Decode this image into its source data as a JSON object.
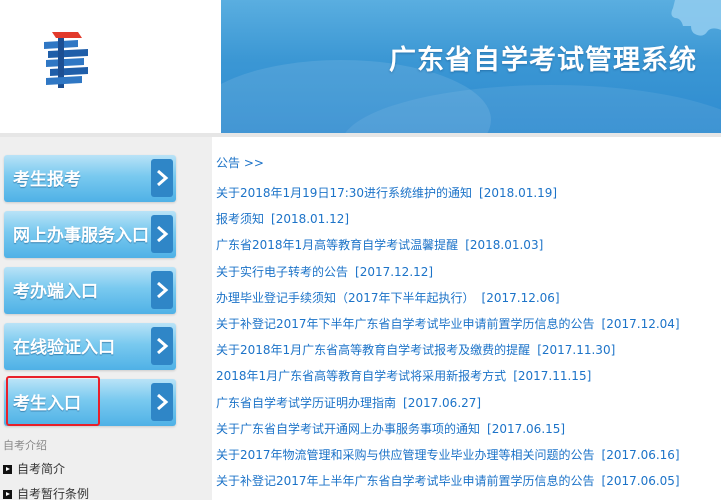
{
  "header": {
    "site_title": "广东省自学考试管理系统",
    "banner_color": "#3b97d4",
    "logo_icon": "exam-logo-icon",
    "decoration_icon": "puzzle-piece-icon"
  },
  "sidebar": {
    "buttons": [
      {
        "label": "考生报考"
      },
      {
        "label": "网上办事服务入口"
      },
      {
        "label": "考办端入口"
      },
      {
        "label": "在线验证入口"
      },
      {
        "label": "考生入口"
      }
    ],
    "highlight_color": "#e8202a",
    "intro_header": "自考介绍",
    "intro_links": [
      "自考简介",
      "自考暂行条例"
    ]
  },
  "notices": {
    "title": "公告 >>",
    "items": [
      {
        "title": "关于2018年1月19日17:30进行系统维护的通知",
        "date": "[2018.01.19]"
      },
      {
        "title": "报考须知",
        "date": "[2018.01.12]"
      },
      {
        "title": "广东省2018年1月高等教育自学考试温馨提醒",
        "date": "[2018.01.03]"
      },
      {
        "title": "关于实行电子转考的公告",
        "date": "[2017.12.12]"
      },
      {
        "title": "办理毕业登记手续须知（2017年下半年起执行）",
        "date": "[2017.12.06]"
      },
      {
        "title": "关于补登记2017年下半年广东省自学考试毕业申请前置学历信息的公告",
        "date": "[2017.12.04]"
      },
      {
        "title": "关于2018年1月广东省高等教育自学考试报考及缴费的提醒",
        "date": "[2017.11.30]"
      },
      {
        "title": "2018年1月广东省高等教育自学考试将采用新报考方式",
        "date": "[2017.11.15]"
      },
      {
        "title": "广东省自学考试学历证明办理指南",
        "date": "[2017.06.27]"
      },
      {
        "title": "关于广东省自学考试开通网上办事服务事项的通知",
        "date": "[2017.06.15]"
      },
      {
        "title": "关于2017年物流管理和采购与供应管理专业毕业办理等相关问题的公告",
        "date": "[2017.06.16]"
      },
      {
        "title": "关于补登记2017年上半年广东省自学考试毕业申请前置学历信息的公告",
        "date": "[2017.06.05]"
      }
    ],
    "link_color": "#1c73c8"
  }
}
